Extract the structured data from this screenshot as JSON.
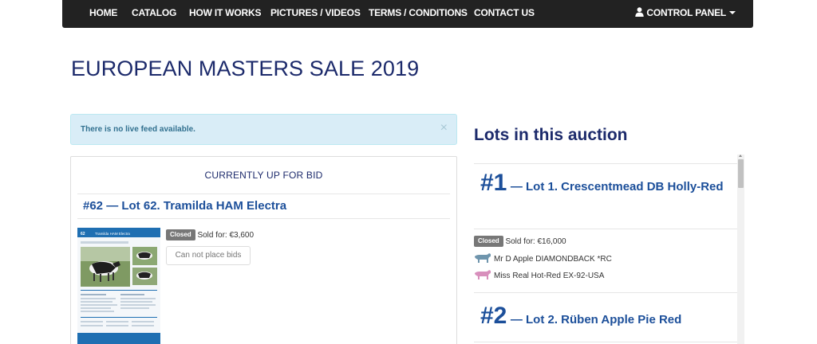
{
  "nav": {
    "items": [
      "HOME",
      "CATALOG",
      "HOW IT WORKS",
      "PICTURES / VIDEOS",
      "TERMS / CONDITIONS",
      "CONTACT US"
    ],
    "control_panel": "CONTROL PANEL"
  },
  "page": {
    "title": "EUROPEAN MASTERS SALE 2019"
  },
  "alert": {
    "text": "There is no live feed available.",
    "close": "×"
  },
  "current_bid": {
    "heading": "CURRENTLY UP FOR BID",
    "lot_title": "#62 — Lot 62. Tramilda HAM Electra",
    "status": "Closed",
    "sold_for": "Sold for: €3,600",
    "bid_button": "Can not place bids",
    "catalog_header": "62",
    "catalog_name": "Tramilda HAM Electra"
  },
  "lots": {
    "title": "Lots in this auction",
    "items": [
      {
        "number": "#1",
        "name": "— Lot 1. Crescentmead DB Holly-Red",
        "status": "Closed",
        "sold_for": "Sold for: €16,000",
        "sire": "Mr D Apple DIAMONDBACK *RC",
        "dam": "Miss Real Hot-Red EX-92-USA"
      },
      {
        "number": "#2",
        "name": "— Lot 2. Rüben Apple Pie Red"
      }
    ]
  },
  "colors": {
    "navbar": "#222222",
    "title": "#1c2a6b",
    "link": "#1c4f9a",
    "alert_bg": "#d9edf7",
    "sire_icon": "#6f95ad",
    "dam_icon": "#d88fbc",
    "catalog_blue": "#1f6fb2"
  }
}
